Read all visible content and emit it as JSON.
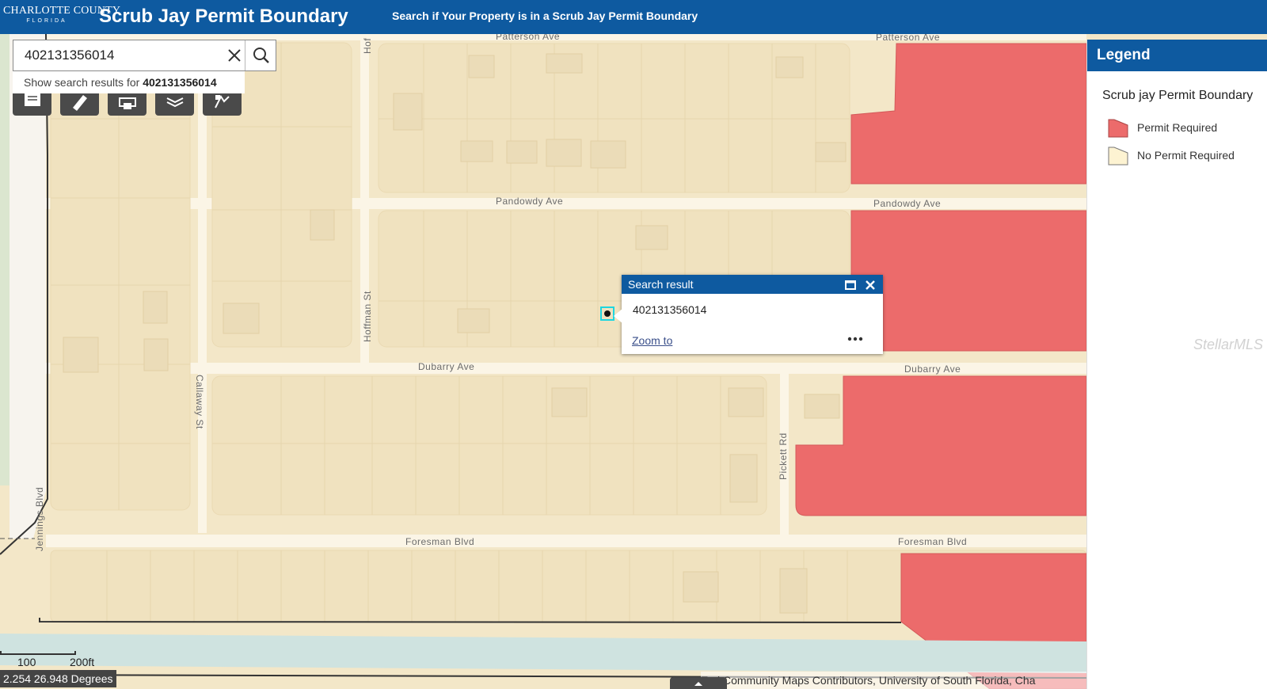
{
  "header": {
    "logo_line1": "CHARLOTTE COUNTY",
    "logo_line2": "FLORIDA",
    "title": "Scrub Jay Permit Boundary",
    "subtitle": "Search if Your Property is in a Scrub Jay Permit Boundary"
  },
  "search": {
    "value": "402131356014",
    "suggestion_prefix": "Show search results for",
    "suggestion_value": "402131356014"
  },
  "toolbar": {
    "tools": [
      "list-icon",
      "measure-icon",
      "print-icon",
      "layers-icon",
      "basemap-icon"
    ]
  },
  "roads": {
    "patterson_left": "Patterson Ave",
    "patterson_right": "Patterson Ave",
    "pandowdy_left": "Pandowdy Ave",
    "pandowdy_right": "Pandowdy Ave",
    "dubarry_left": "Dubarry Ave",
    "dubarry_right": "Dubarry Ave",
    "foresman_left": "Foresman Blvd",
    "foresman_right": "Foresman Blvd",
    "hoffman_top": "Hof",
    "hoffman": "Hoffman St",
    "callaway": "Callaway St",
    "pickett": "Pickett Rd",
    "jennings": "Jennings Blvd"
  },
  "popup": {
    "title": "Search result",
    "value": "402131356014",
    "zoom_label": "Zoom to"
  },
  "legend": {
    "title": "Legend",
    "layer_name": "Scrub jay Permit Boundary",
    "items": [
      {
        "label": "Permit Required",
        "color": "#ec6b6b"
      },
      {
        "label": "No Permit Required",
        "color": "#fdf3d2"
      }
    ]
  },
  "map_footer": {
    "coordinates": "2.254 26.948 Degrees",
    "scale_100": "100",
    "scale_200": "200ft",
    "attribution": "Esri Community Maps Contributors, University of South Florida, Cha"
  },
  "watermark": "StellarMLS",
  "colors": {
    "header": "#0e5aa0",
    "permit_required": "#ec6b6b",
    "no_permit": "#f3e7c8",
    "marker": "#1ed6e0"
  }
}
